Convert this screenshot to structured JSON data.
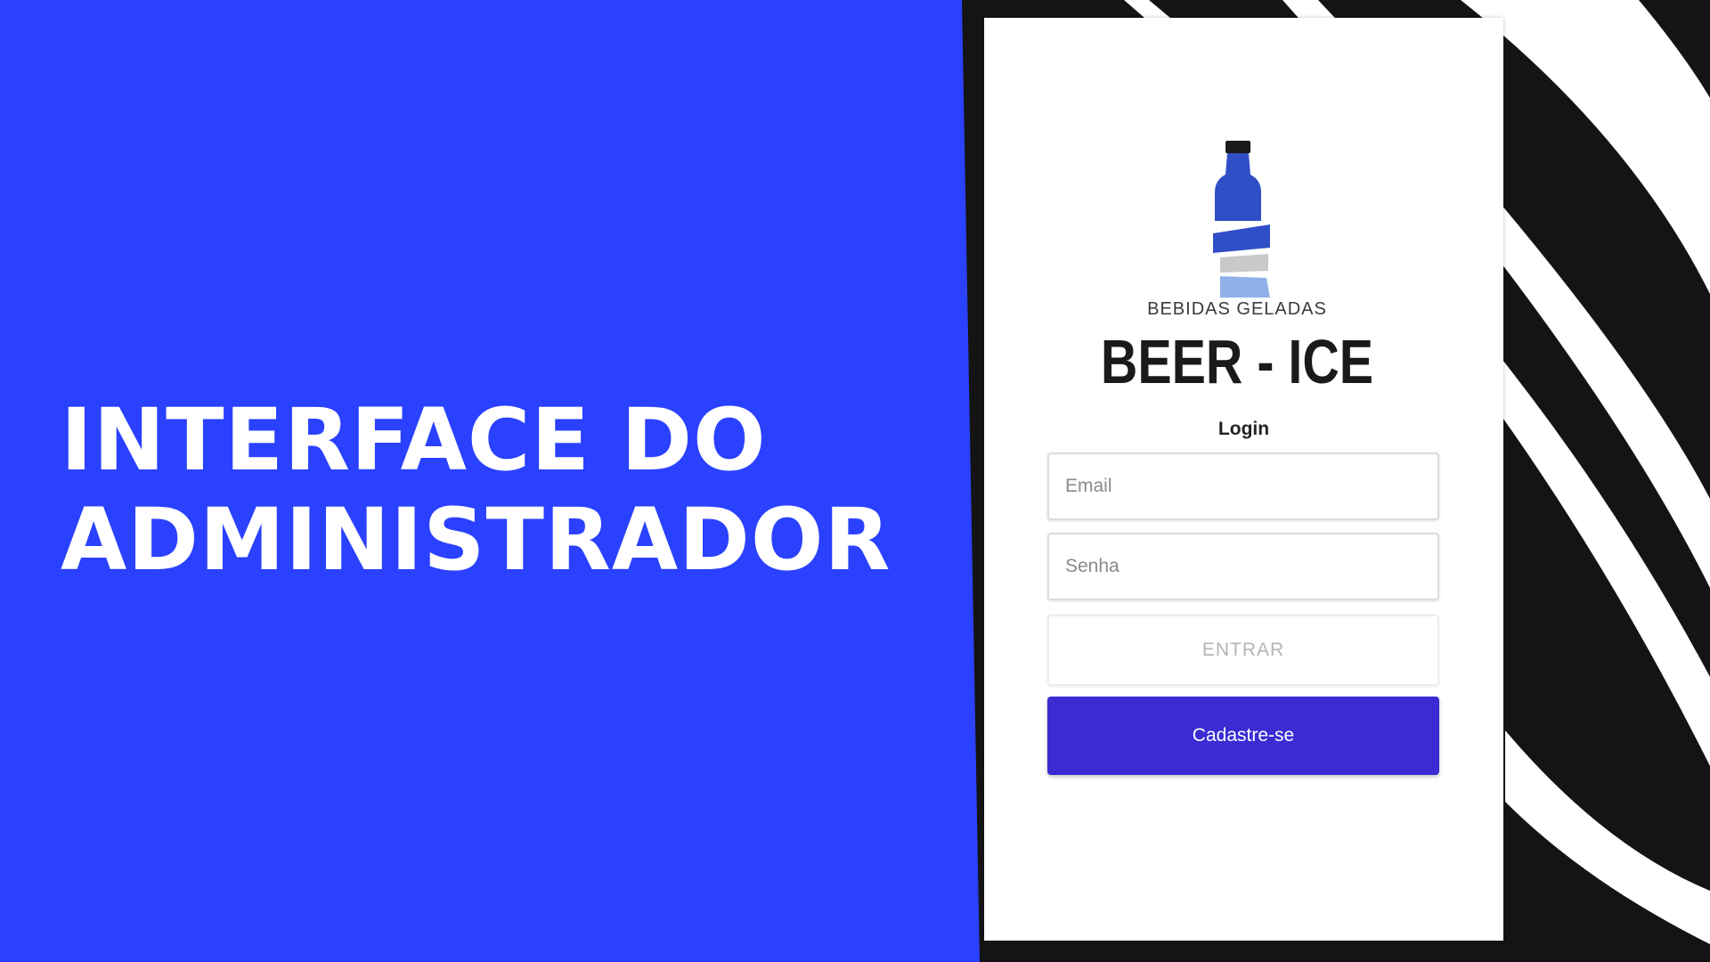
{
  "slide": {
    "headline_line1": "INTERFACE DO",
    "headline_line2": "ADMINISTRADOR"
  },
  "login_card": {
    "brand_tagline": "BEBIDAS GELADAS",
    "brand_name": "BEER - ICE",
    "login_label": "Login",
    "email_placeholder": "Email",
    "password_placeholder": "Senha",
    "submit_label": "ENTRAR",
    "register_label": "Cadastre-se"
  },
  "colors": {
    "background_blue": "#2a41ff",
    "stripe_black": "#141414",
    "stripe_white": "#ffffff",
    "register_button": "#3b2bd3",
    "bottle_blue": "#2f4fc7",
    "bottle_grey": "#c9c9c9",
    "bottle_light_blue": "#8fb1ea"
  },
  "icons": {
    "logo": "bottle-icon"
  }
}
